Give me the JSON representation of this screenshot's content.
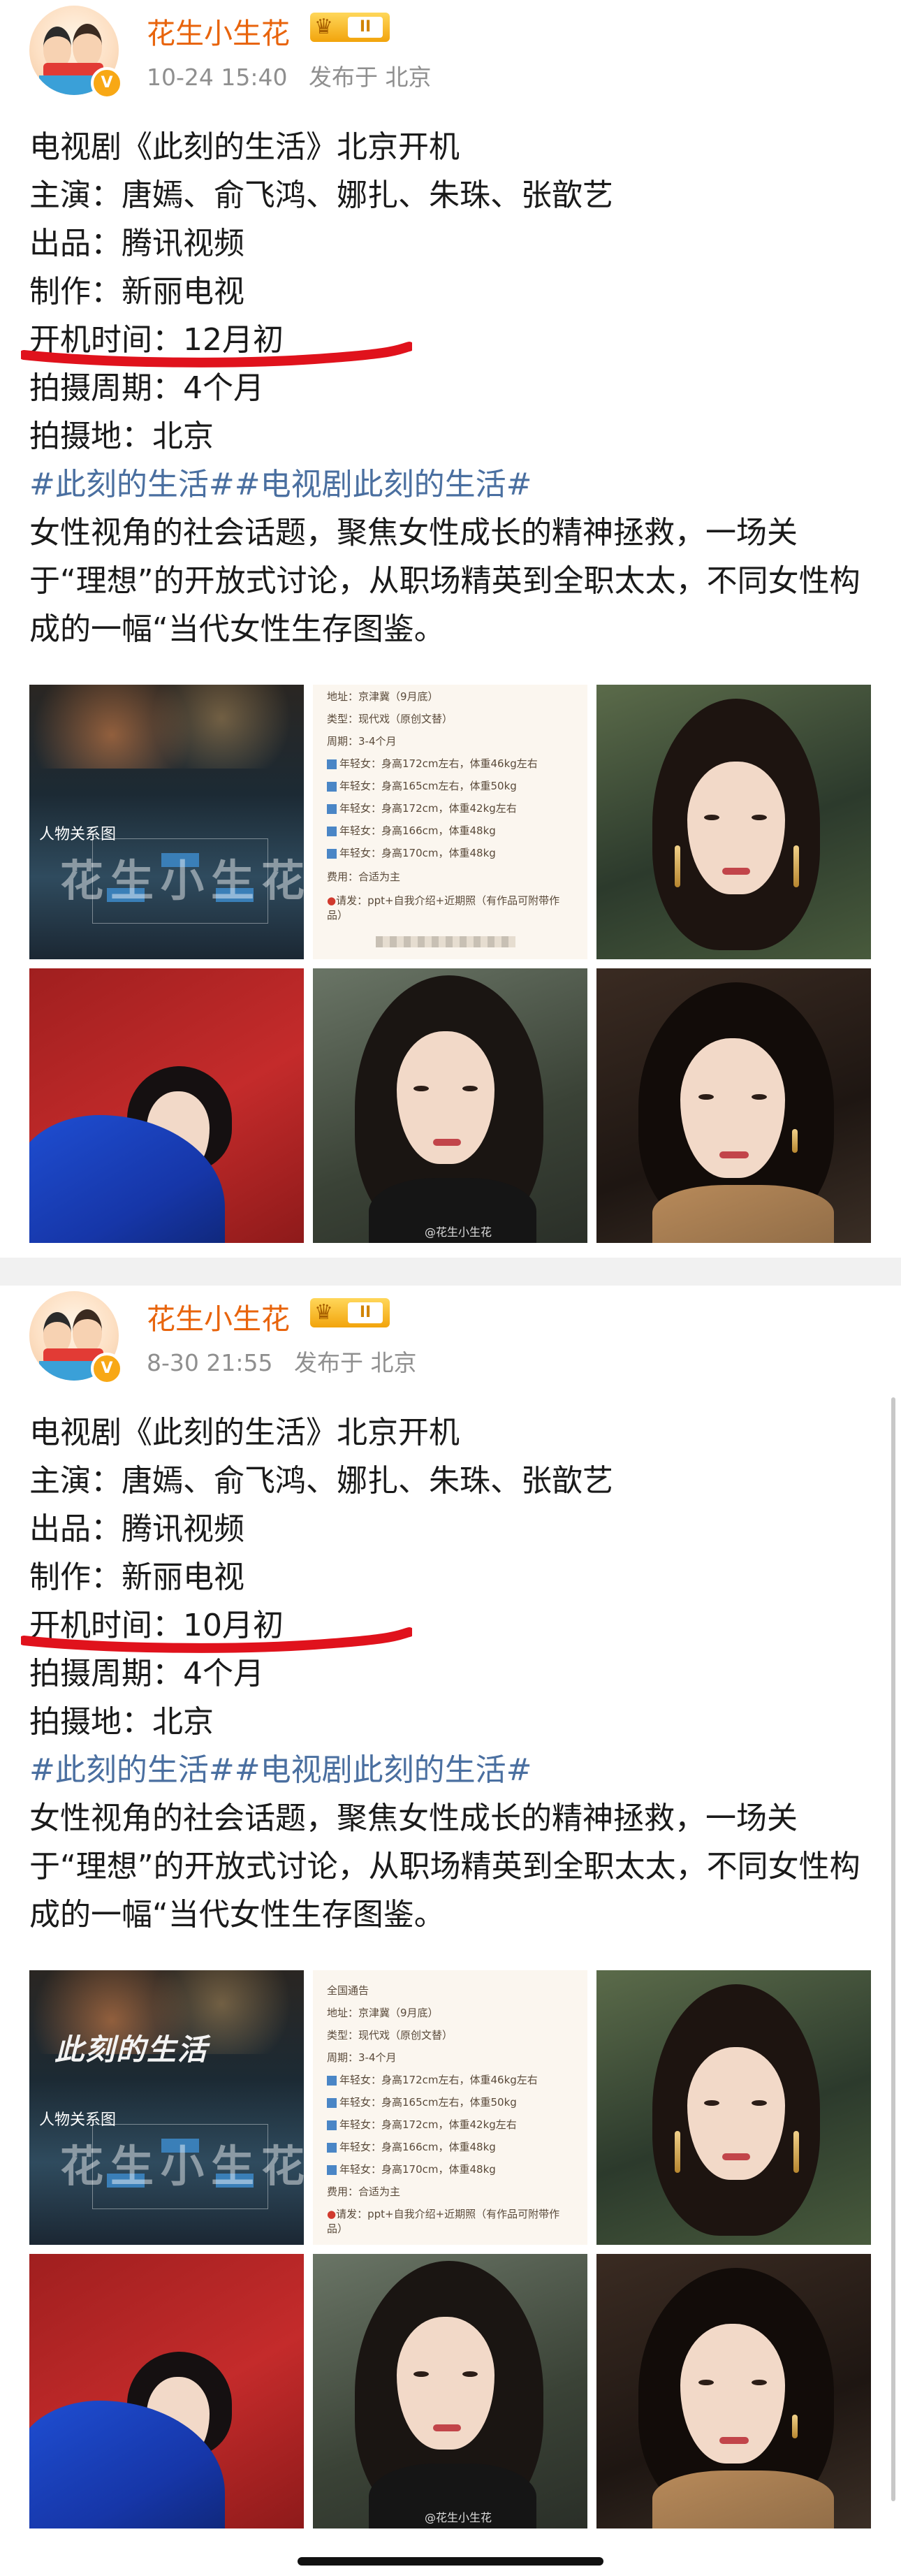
{
  "posts": [
    {
      "username": "花生小生花",
      "level": "II",
      "time": "10-24 15:40",
      "location": "发布于 北京",
      "lines": [
        "电视剧《此刻的生活》北京开机",
        "主演：唐嫣、俞飞鸿、娜扎、朱珠、张歆艺",
        "出品：腾讯视频",
        "制作：新丽电视",
        "开机时间：12月初",
        "拍摄周期：4个月",
        "拍摄地：北京"
      ],
      "hashtags": "#此刻的生活##电视剧此刻的生活#",
      "paragraph": "女性视角的社会话题，聚焦女性成长的精神拯救，一场关于“理想”的开放式讨论，从职场精英到全职太太，不同女性构成的一幅“当代女性生存图鉴。",
      "images": {
        "relations_label": "人物关系图",
        "relations_title": "",
        "relations_watermark": "花生小生花",
        "doc_lines": [
          "地址：京津冀（9月底）",
          "类型：现代戏（原创文替）",
          "周期：3-4个月",
          "年轻女：身高172cm左右，体重46kg左右",
          "年轻女：身高165cm左右，体重50kg",
          "年轻女：身高172cm，体重42kg左右",
          "年轻女：身高166cm，体重48kg",
          "年轻女：身高170cm，体重48kg",
          "费用：合适为主",
          "请发：ppt+自我介绍+近期照（有作品可附带作品）"
        ],
        "photo_watermark": "@花生小生花"
      }
    },
    {
      "username": "花生小生花",
      "level": "II",
      "time": "8-30 21:55",
      "location": "发布于 北京",
      "lines": [
        "电视剧《此刻的生活》北京开机",
        "主演：唐嫣、俞飞鸿、娜扎、朱珠、张歆艺",
        "出品：腾讯视频",
        "制作：新丽电视",
        "开机时间：10月初",
        "拍摄周期：4个月",
        "拍摄地：北京"
      ],
      "hashtags": "#此刻的生活##电视剧此刻的生活#",
      "paragraph": "女性视角的社会话题，聚焦女性成长的精神拯救，一场关于“理想”的开放式讨论，从职场精英到全职太太，不同女性构成的一幅“当代女性生存图鉴。",
      "images": {
        "relations_label": "人物关系图",
        "relations_title": "此刻的生活",
        "relations_watermark": "花生小生花",
        "doc_lines": [
          "全国通告",
          "地址：京津冀（9月底）",
          "类型：现代戏（原创文替）",
          "周期：3-4个月",
          "年轻女：身高172cm左右，体重46kg左右",
          "年轻女：身高165cm左右，体重50kg",
          "年轻女：身高172cm，体重42kg左右",
          "年轻女：身高166cm，体重48kg",
          "年轻女：身高170cm，体重48kg",
          "费用：合适为主",
          "请发：ppt+自我介绍+近期照（有作品可附带作品）"
        ],
        "photo_watermark": "@花生小生花"
      }
    }
  ],
  "colors": {
    "username": "#e8640c",
    "hashtag": "#4a6fa0",
    "underline": "#e0121c",
    "meta": "#8f8f8f"
  }
}
